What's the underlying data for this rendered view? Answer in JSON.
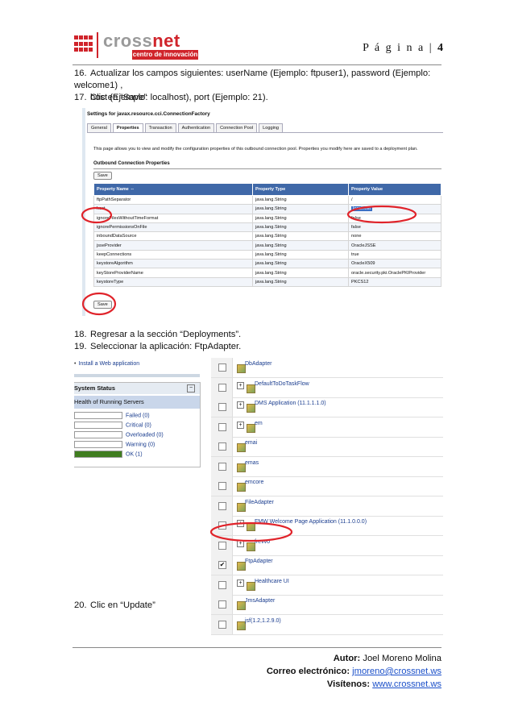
{
  "header": {
    "logo_name_a": "cross",
    "logo_name_b": "net",
    "logo_subtitle": "centro de innovación",
    "page_label": "P á g i n a",
    "page_number": "4"
  },
  "steps": [
    {
      "n": "16.",
      "text": "Actualizar los campos siguientes: userName (Ejemplo: ftpuser1),  password (Ejemplo: welcome1) ,",
      "cont": "host (Ejemplo: localhost), port (Ejemplo: 21)."
    },
    {
      "n": "17.",
      "text": "Clic en “Save”"
    },
    {
      "n": "18.",
      "text": "Regresar a la sección “Deployments”."
    },
    {
      "n": "19.",
      "text": "Seleccionar la aplicación: FtpAdapter."
    },
    {
      "n": "20.",
      "text": "Clic en “Update”"
    }
  ],
  "screenshot1": {
    "title": "Settings for javax.resource.cci.ConnectionFactory",
    "tabs": [
      "General",
      "Properties",
      "Transaction",
      "Authentication",
      "Connection Pool",
      "Logging"
    ],
    "active_tab": "Properties",
    "description": "This page allows you to view and modify the configuration properties of this outbound connection pool. Properties you modify here are saved to a deployment plan.",
    "section": "Outbound Connection Properties",
    "save_label": "Save",
    "columns": [
      "Property Name ⇔",
      "Property Type",
      "Property Value"
    ],
    "rows": [
      [
        "ftpPathSeparator",
        "java.lang.String",
        "/"
      ],
      [
        "host",
        "java.lang.String",
        "localhost"
      ],
      [
        "ignoreFilesWithoutTimeFormat",
        "java.lang.String",
        "false"
      ],
      [
        "ignorePermissionsOnFile",
        "java.lang.String",
        "false"
      ],
      [
        "inboundDataSource",
        "java.lang.String",
        "none"
      ],
      [
        "jsseProvider",
        "java.lang.String",
        "OracleJSSE"
      ],
      [
        "keepConnections",
        "java.lang.String",
        "true"
      ],
      [
        "keystoreAlgorithm",
        "java.lang.String",
        "OracleX509"
      ],
      [
        "keyStoreProviderName",
        "java.lang.String",
        "oracle.security.pki.OraclePKIProvider"
      ],
      [
        "keystoreType",
        "java.lang.String",
        "PKCS12"
      ]
    ]
  },
  "screenshot2": {
    "install_link": "Install a Web application",
    "system_status": "System Status",
    "health": "Health of Running Servers",
    "statuses": [
      {
        "label": "Failed (0)",
        "color": "#ffffff"
      },
      {
        "label": "Critical (0)",
        "color": "#ffffff"
      },
      {
        "label": "Overloaded (0)",
        "color": "#ffffff"
      },
      {
        "label": "Warning (0)",
        "color": "#ffffff"
      },
      {
        "label": "OK (1)",
        "color": "#3f7d1f"
      }
    ],
    "deployments": [
      {
        "name": "DbAdapter",
        "expand": false,
        "checked": false
      },
      {
        "name": "DefaultToDoTaskFlow",
        "expand": true,
        "checked": false
      },
      {
        "name": "DMS Application (11.1.1.1.0)",
        "expand": true,
        "checked": false
      },
      {
        "name": "em",
        "expand": true,
        "checked": false
      },
      {
        "name": "emai",
        "expand": false,
        "checked": false
      },
      {
        "name": "emas",
        "expand": false,
        "checked": false
      },
      {
        "name": "emcore",
        "expand": false,
        "checked": false
      },
      {
        "name": "FileAdapter",
        "expand": false,
        "checked": false
      },
      {
        "name": "FMW Welcome Page Application (11.1.0.0.0)",
        "expand": true,
        "checked": false
      },
      {
        "name": "frevvo",
        "expand": true,
        "checked": false
      },
      {
        "name": "FtpAdapter",
        "expand": false,
        "checked": true
      },
      {
        "name": "Healthcare UI",
        "expand": true,
        "checked": false
      },
      {
        "name": "JmsAdapter",
        "expand": false,
        "checked": false
      },
      {
        "name": "jsf(1.2,1.2.9.0)",
        "expand": false,
        "checked": false
      }
    ]
  },
  "footer": {
    "author_label": "Autor:",
    "author": "Joel Moreno Molina",
    "email_label": "Correo electrónico:",
    "email": "jmoreno@crossnet.ws",
    "visit_label": "Visítenos:",
    "website": "www.crossnet.ws"
  },
  "colors": {
    "brand_red": "#d0242b",
    "table_header": "#3f68a8",
    "annotation_red": "#e0232a",
    "link_blue": "#1a4fc9"
  }
}
